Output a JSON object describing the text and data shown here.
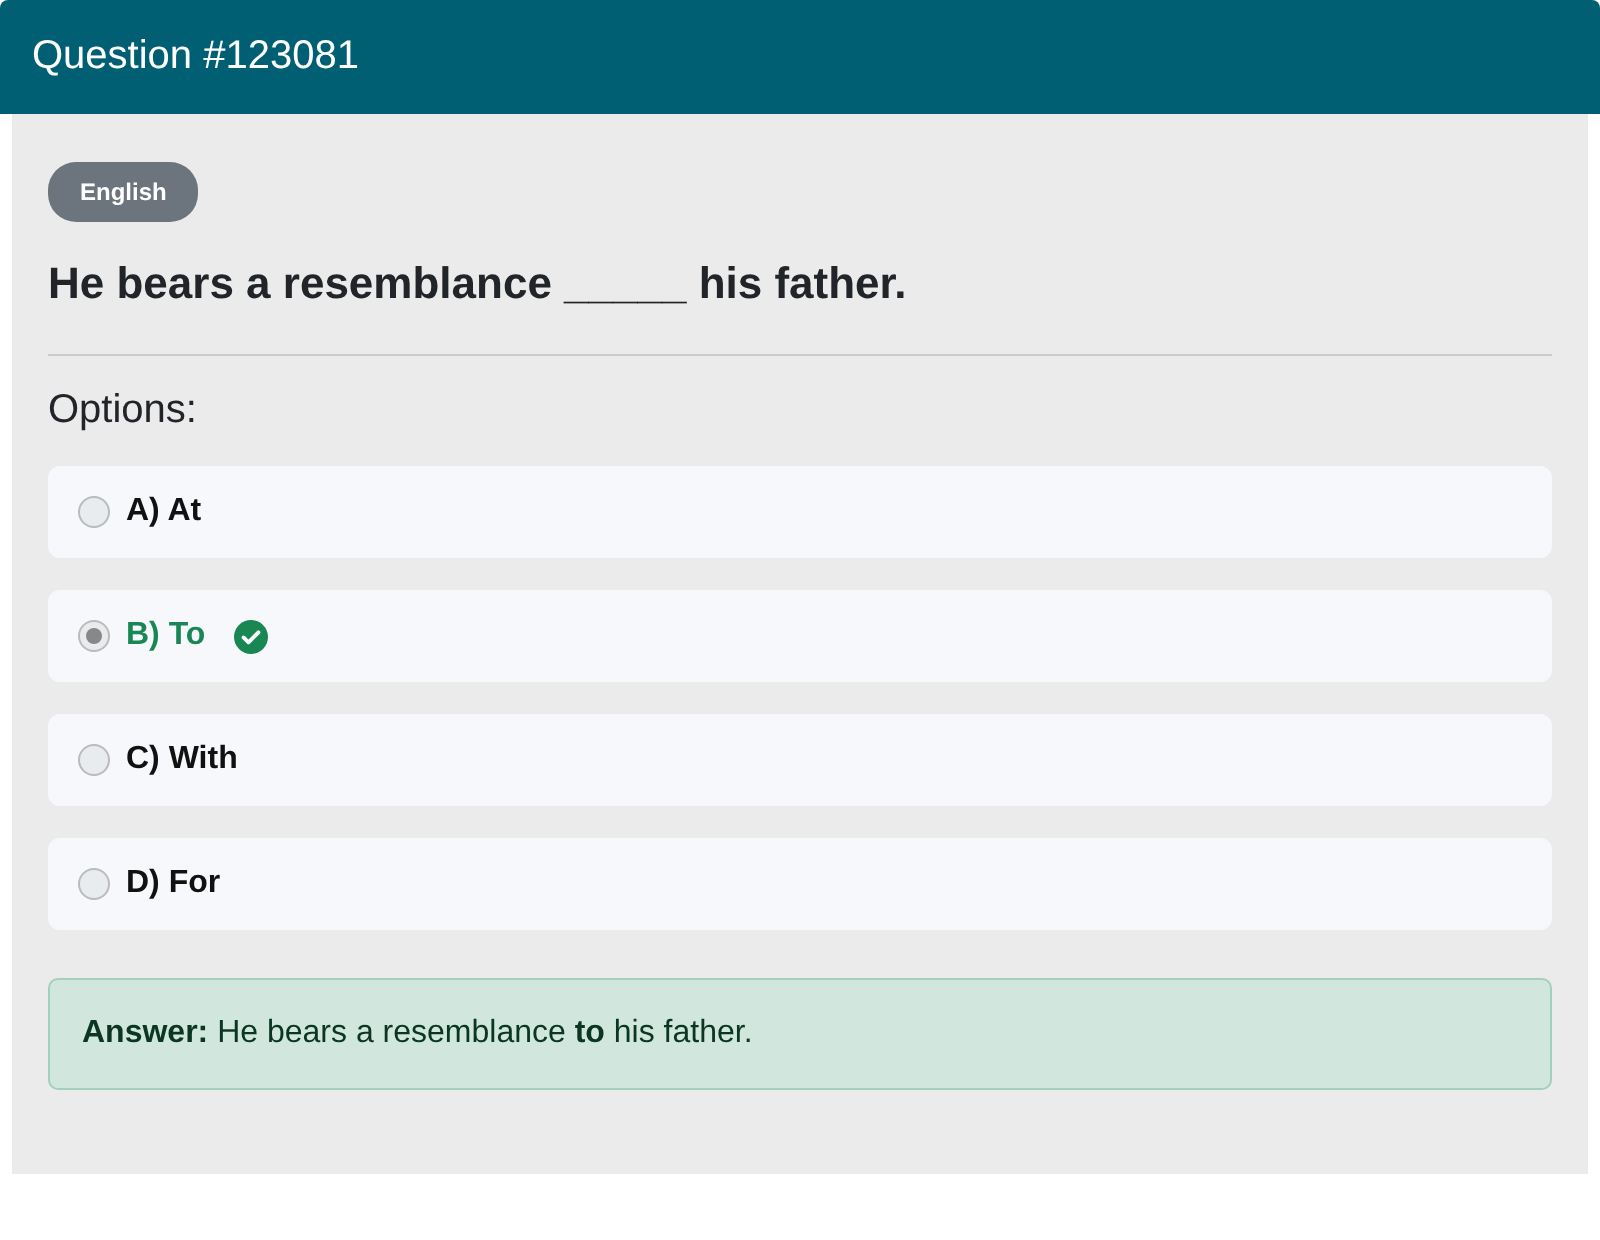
{
  "header": {
    "title": "Question #123081"
  },
  "tag": "English",
  "question": "He bears a resemblance _____ his father.",
  "options_label": "Options:",
  "options": [
    {
      "label": "A) At",
      "selected": false,
      "correct": false
    },
    {
      "label": "B) To",
      "selected": true,
      "correct": true
    },
    {
      "label": "C) With",
      "selected": false,
      "correct": false
    },
    {
      "label": "D) For",
      "selected": false,
      "correct": false
    }
  ],
  "answer": "**Answer:** He bears a resemblance **to** his father."
}
